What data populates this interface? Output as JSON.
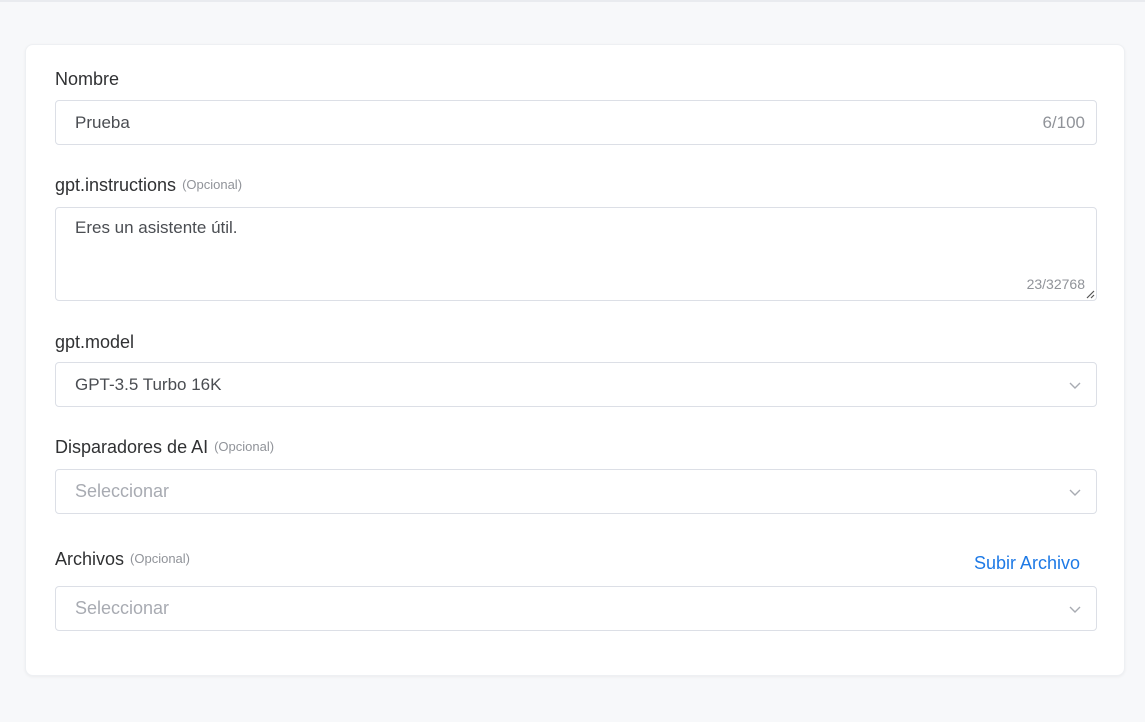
{
  "form": {
    "name": {
      "label": "Nombre",
      "value": "Prueba",
      "counter": "6/100"
    },
    "instructions": {
      "label": "gpt.instructions",
      "optional": "(Opcional)",
      "value": "Eres un asistente útil.",
      "counter": "23/32768"
    },
    "model": {
      "label": "gpt.model",
      "value": "GPT-3.5 Turbo 16K"
    },
    "triggers": {
      "label": "Disparadores de AI",
      "optional": "(Opcional)",
      "placeholder": "Seleccionar"
    },
    "files": {
      "label": "Archivos",
      "optional": "(Opcional)",
      "upload_label": "Subir Archivo",
      "placeholder": "Seleccionar"
    }
  },
  "icons": {
    "select_arrow": "chevron-down-icon",
    "textarea_resize": "resize-handle-icon"
  },
  "colors": {
    "accent": "#1e7ae6",
    "border": "#dcdfe6",
    "placeholder": "#a8abb2",
    "muted": "#909399"
  }
}
